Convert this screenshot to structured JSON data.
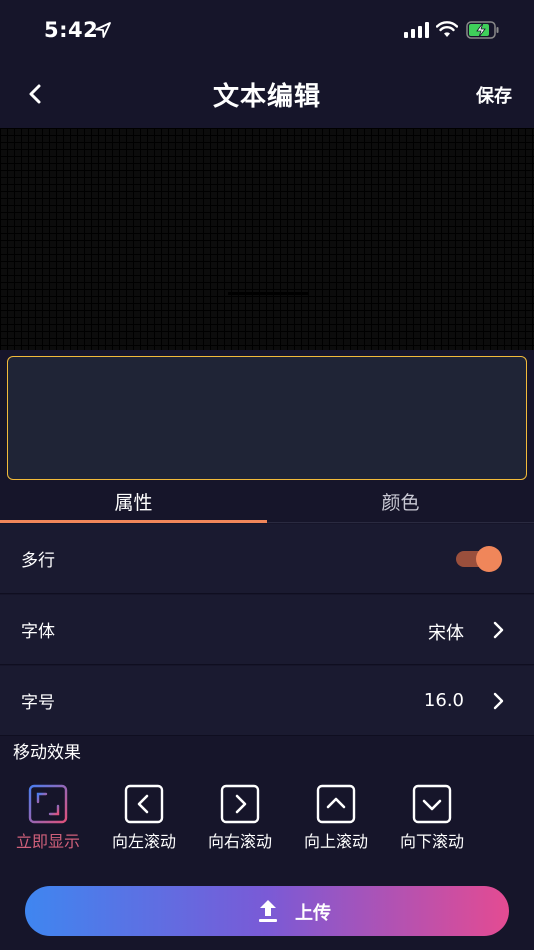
{
  "status_bar": {
    "time": "5:42",
    "location_icon": "location-arrow-icon",
    "signal_icon": "cellular-signal-icon",
    "wifi_icon": "wifi-icon",
    "battery_icon": "battery-charging-icon"
  },
  "nav": {
    "title": "文本编辑",
    "save_label": "保存",
    "back_icon": "chevron-left-icon"
  },
  "preview": {
    "background_color": "#0c0c0c"
  },
  "text_input": {
    "value": "",
    "border_color": "#f2bb3a"
  },
  "tabs": [
    {
      "label": "属性",
      "active": true
    },
    {
      "label": "颜色",
      "active": false
    }
  ],
  "settings": {
    "multiline": {
      "label": "多行",
      "enabled": true
    },
    "font": {
      "label": "字体",
      "value": "宋体"
    },
    "font_size": {
      "label": "字号",
      "value": "16.0"
    }
  },
  "effects": {
    "title": "移动效果",
    "items": [
      {
        "label": "立即显示",
        "icon": "instant-display-icon",
        "active": true
      },
      {
        "label": "向左滚动",
        "icon": "scroll-left-icon",
        "active": false
      },
      {
        "label": "向右滚动",
        "icon": "scroll-right-icon",
        "active": false
      },
      {
        "label": "向上滚动",
        "icon": "scroll-up-icon",
        "active": false
      },
      {
        "label": "向下滚动",
        "icon": "scroll-down-icon",
        "active": false
      }
    ]
  },
  "upload": {
    "label": "上传",
    "icon": "upload-icon"
  },
  "colors": {
    "accent": "#f0865a",
    "active_effect": "#d0607a",
    "background": "#16152a"
  }
}
